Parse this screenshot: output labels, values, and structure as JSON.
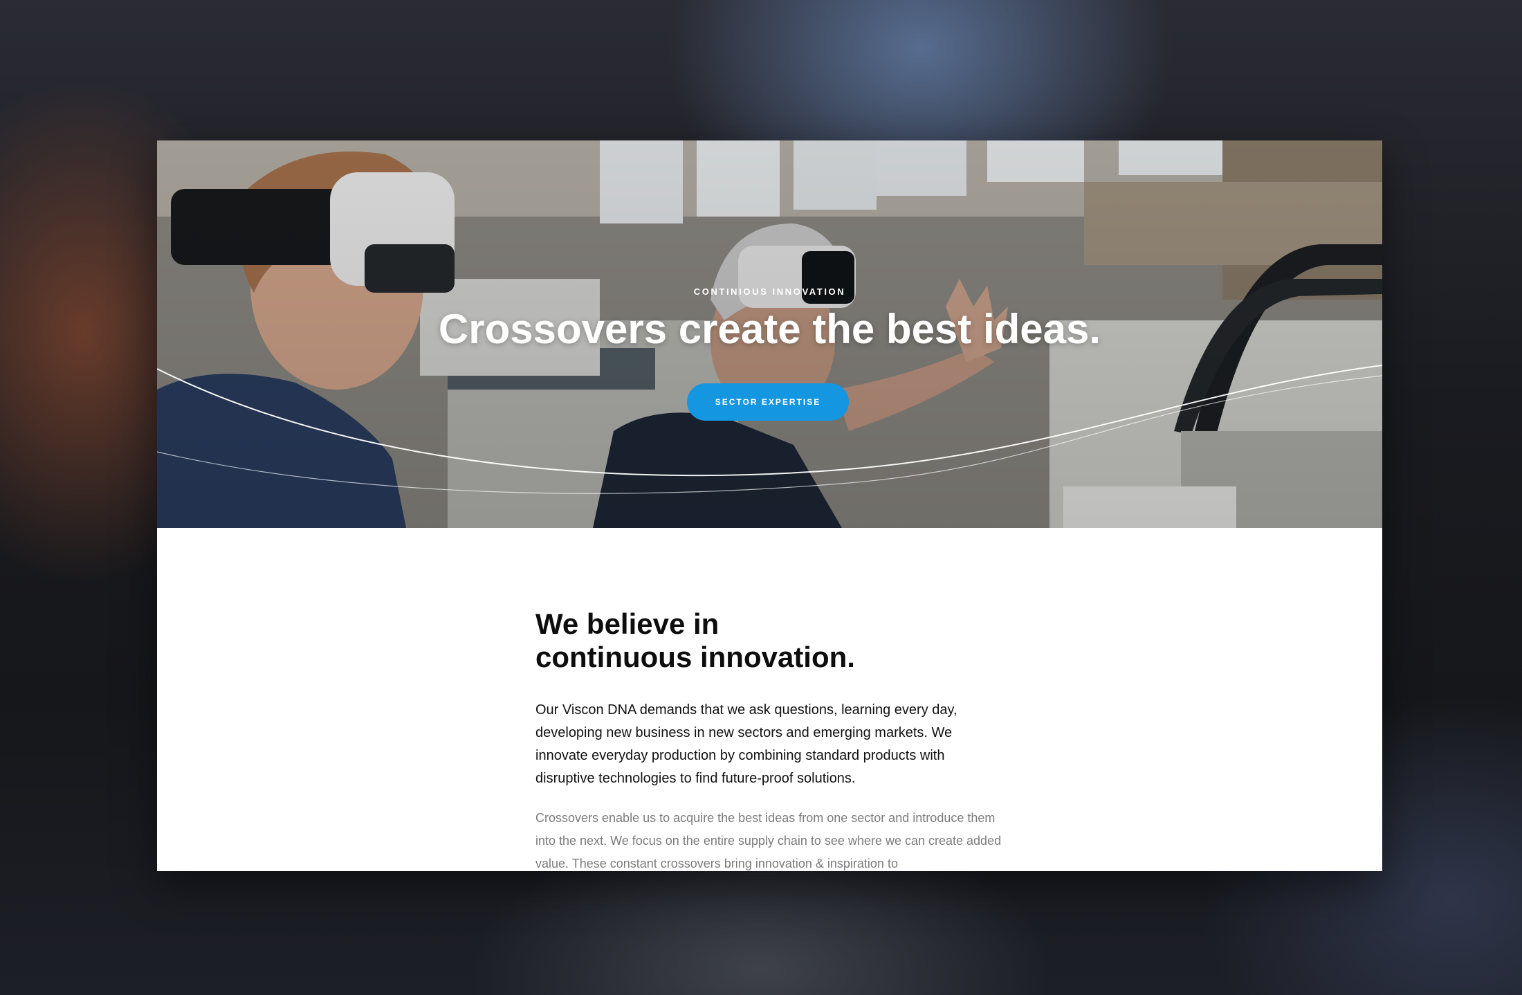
{
  "hero": {
    "eyebrow": "CONTINIOUS INNOVATION",
    "title": "Crossovers create the best ideas.",
    "cta_label": "SECTOR EXPERTISE"
  },
  "intro": {
    "heading_line1": "We believe in",
    "heading_line2": "continuous innovation.",
    "lead": "Our Viscon DNA demands that we ask questions, learning every day, developing new business in new sectors and emerging markets. We innovate everyday production by combining standard products with disruptive technologies to find future-proof solutions.",
    "body": "Crossovers enable us to acquire the best ideas from one sector and introduce them into the next. We focus on the entire supply chain to see where we can create added value. These constant crossovers bring innovation & inspiration to"
  },
  "colors": {
    "accent": "#1596e0",
    "heading": "#0d0d0d",
    "body": "#7b7b7b"
  }
}
